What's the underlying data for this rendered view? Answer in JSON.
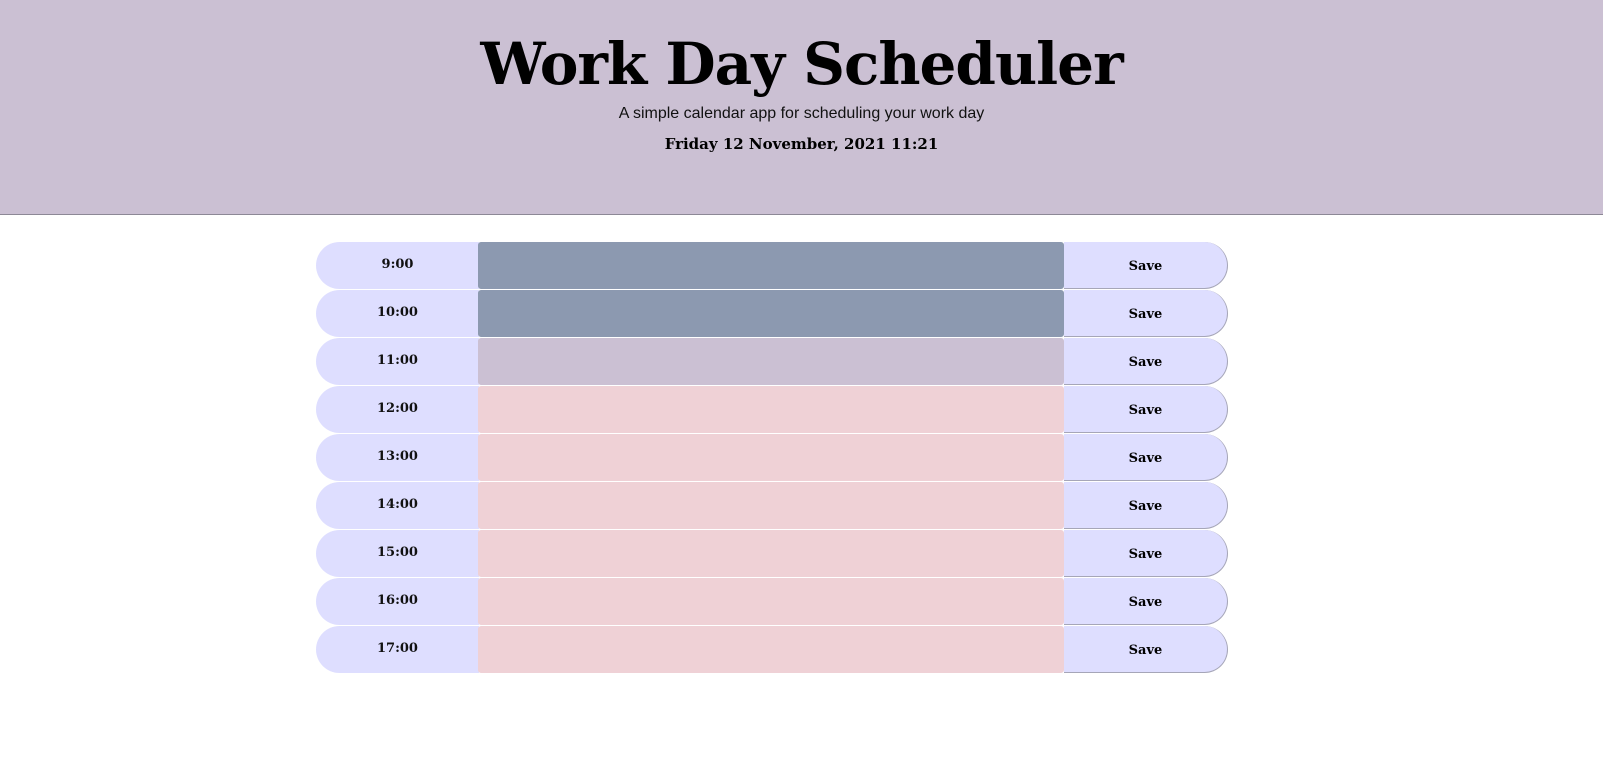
{
  "header": {
    "title": "Work Day Scheduler",
    "subtitle": "A simple calendar app for scheduling your work day",
    "current_day": "Friday 12 November, 2021 11:21"
  },
  "colors": {
    "header_bg": "#cbc0d3",
    "past": "#8c99b0",
    "present": "#cbc0d3",
    "future": "#efd1d6",
    "hour_bg": "#dedeff"
  },
  "schedule": [
    {
      "hour": "9:00",
      "state": "past",
      "text": "",
      "save_label": "Save"
    },
    {
      "hour": "10:00",
      "state": "past",
      "text": "",
      "save_label": "Save"
    },
    {
      "hour": "11:00",
      "state": "present",
      "text": "",
      "save_label": "Save"
    },
    {
      "hour": "12:00",
      "state": "future",
      "text": "",
      "save_label": "Save"
    },
    {
      "hour": "13:00",
      "state": "future",
      "text": "",
      "save_label": "Save"
    },
    {
      "hour": "14:00",
      "state": "future",
      "text": "",
      "save_label": "Save"
    },
    {
      "hour": "15:00",
      "state": "future",
      "text": "",
      "save_label": "Save"
    },
    {
      "hour": "16:00",
      "state": "future",
      "text": "",
      "save_label": "Save"
    },
    {
      "hour": "17:00",
      "state": "future",
      "text": "",
      "save_label": "Save"
    }
  ]
}
